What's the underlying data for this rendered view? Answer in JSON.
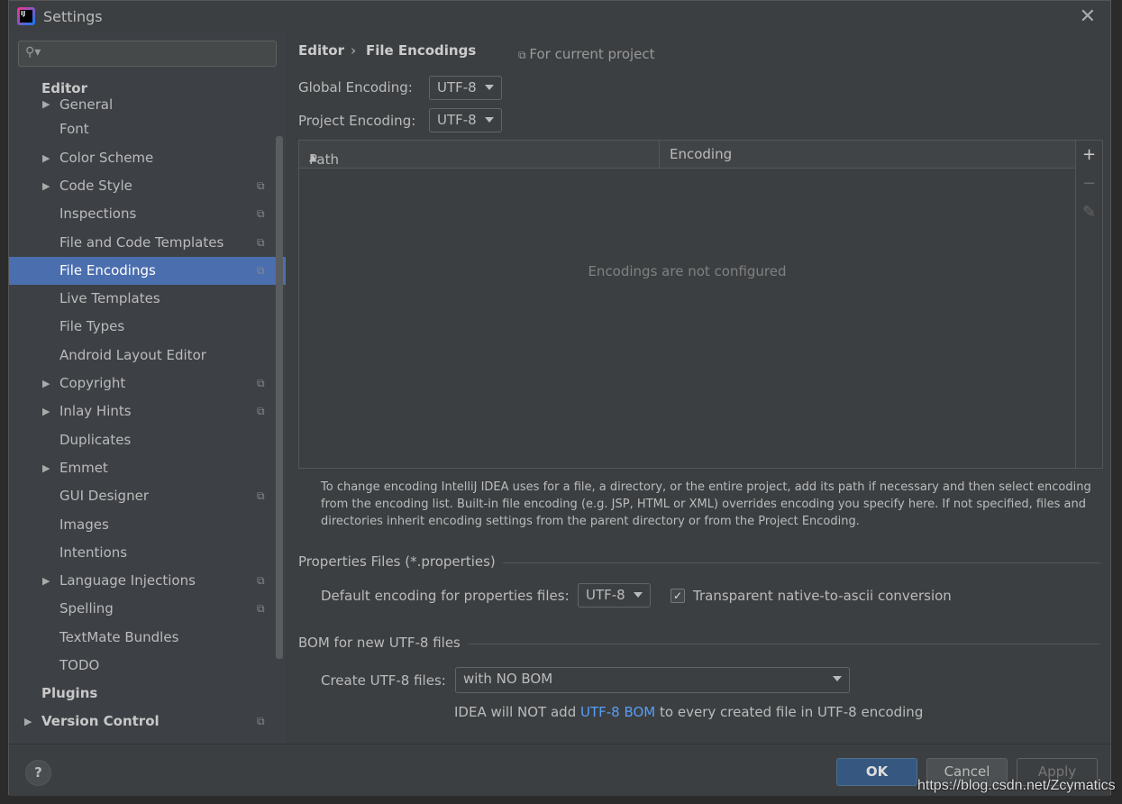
{
  "window": {
    "title": "Settings",
    "close_icon": "close-icon"
  },
  "sidebar": {
    "search_placeholder": "",
    "section_editor": "Editor",
    "items": [
      {
        "label": "General",
        "arrow": true,
        "proj": false
      },
      {
        "label": "Font",
        "arrow": false,
        "proj": false
      },
      {
        "label": "Color Scheme",
        "arrow": true,
        "proj": false
      },
      {
        "label": "Code Style",
        "arrow": true,
        "proj": true
      },
      {
        "label": "Inspections",
        "arrow": false,
        "proj": true
      },
      {
        "label": "File and Code Templates",
        "arrow": false,
        "proj": true
      },
      {
        "label": "File Encodings",
        "arrow": false,
        "proj": true,
        "selected": true
      },
      {
        "label": "Live Templates",
        "arrow": false,
        "proj": false
      },
      {
        "label": "File Types",
        "arrow": false,
        "proj": false
      },
      {
        "label": "Android Layout Editor",
        "arrow": false,
        "proj": false
      },
      {
        "label": "Copyright",
        "arrow": true,
        "proj": true
      },
      {
        "label": "Inlay Hints",
        "arrow": true,
        "proj": true
      },
      {
        "label": "Duplicates",
        "arrow": false,
        "proj": false
      },
      {
        "label": "Emmet",
        "arrow": true,
        "proj": false
      },
      {
        "label": "GUI Designer",
        "arrow": false,
        "proj": true
      },
      {
        "label": "Images",
        "arrow": false,
        "proj": false
      },
      {
        "label": "Intentions",
        "arrow": false,
        "proj": false
      },
      {
        "label": "Language Injections",
        "arrow": true,
        "proj": true
      },
      {
        "label": "Spelling",
        "arrow": false,
        "proj": true
      },
      {
        "label": "TextMate Bundles",
        "arrow": false,
        "proj": false
      },
      {
        "label": "TODO",
        "arrow": false,
        "proj": false
      }
    ],
    "section_plugins": "Plugins",
    "section_vcs": "Version Control"
  },
  "main": {
    "breadcrumb": [
      "Editor",
      "File Encodings"
    ],
    "for_current_project": "For current project",
    "global_encoding_label": "Global Encoding:",
    "global_encoding": "UTF-8",
    "project_encoding_label": "Project Encoding:",
    "project_encoding": "UTF-8",
    "table": {
      "columns": [
        "Path",
        "Encoding"
      ],
      "empty_text": "Encodings are not configured"
    },
    "note": "To change encoding IntelliJ IDEA uses for a file, a directory, or the entire project, add its path if necessary and then select encoding from the encoding list. Built-in file encoding (e.g. JSP, HTML or XML) overrides encoding you specify here. If not specified, files and directories inherit encoding settings from the parent directory or from the Project Encoding.",
    "properties": {
      "title": "Properties Files (*.properties)",
      "default_label": "Default encoding for properties files:",
      "default_value": "UTF-8",
      "transparent_label": "Transparent native-to-ascii conversion",
      "transparent_checked": true
    },
    "bom": {
      "title": "BOM for new UTF-8 files",
      "create_label": "Create UTF-8 files:",
      "create_value": "with NO BOM",
      "info_prefix": "IDEA will NOT add ",
      "info_link": "UTF-8 BOM",
      "info_suffix": " to every created file in UTF-8 encoding"
    }
  },
  "footer": {
    "help": "?",
    "ok": "OK",
    "cancel": "Cancel",
    "apply": "Apply"
  },
  "watermark": "https://blog.csdn.net/Zcymatics",
  "colors": {
    "selection": "#4b6eaf",
    "ok_button": "#365880",
    "link": "#589df6"
  }
}
